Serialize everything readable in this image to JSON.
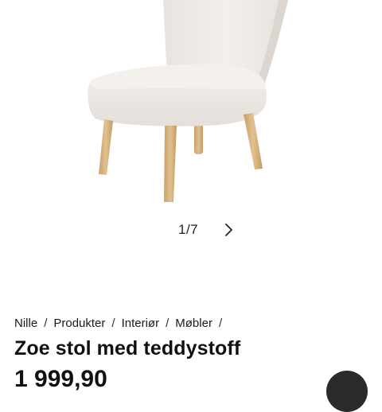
{
  "gallery": {
    "image_alt": "Zoe stol med teddystoff",
    "counter": "1/7",
    "next_icon": "chevron-right-icon"
  },
  "breadcrumb": {
    "items": [
      "Nille",
      "Produkter",
      "Interiør",
      "Møbler"
    ],
    "separator": "/"
  },
  "product": {
    "title": "Zoe stol med teddystoff",
    "price": "1 999,90"
  },
  "colors": {
    "fabric": "#efebe7",
    "legs": "#d9b683",
    "fab": "#2b2b2b"
  }
}
